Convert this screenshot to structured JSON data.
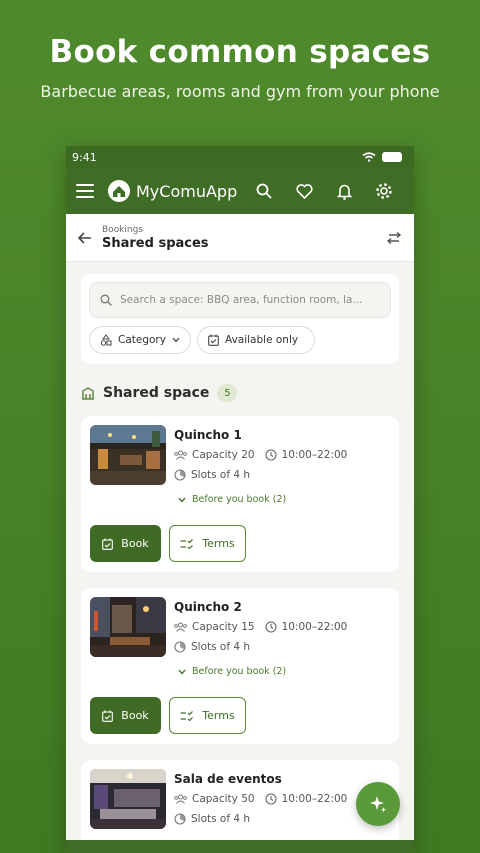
{
  "hero": {
    "title": "Book common spaces",
    "subtitle": "Barbecue areas, rooms and gym from your phone"
  },
  "status": {
    "time": "9:41"
  },
  "appbar": {
    "name": "MyComuApp"
  },
  "subheader": {
    "crumb": "Bookings",
    "title": "Shared spaces"
  },
  "search": {
    "placeholder": "Search a space: BBQ area, function room, la..."
  },
  "filters": {
    "category": "Category",
    "available": "Available only"
  },
  "section": {
    "title": "Shared space",
    "count": "5"
  },
  "spaces": [
    {
      "name": "Quincho 1",
      "capacity": "Capacity 20",
      "hours": "10:00–22:00",
      "slots": "Slots of 4 h",
      "before": "Before you book (2)",
      "book": "Book",
      "terms": "Terms"
    },
    {
      "name": "Quincho 2",
      "capacity": "Capacity 15",
      "hours": "10:00–22:00",
      "slots": "Slots of 4 h",
      "before": "Before you book (2)",
      "book": "Book",
      "terms": "Terms"
    },
    {
      "name": "Sala de eventos",
      "capacity": "Capacity 50",
      "hours": "10:00–22:00",
      "slots": "Slots of 4 h"
    }
  ],
  "colors": {
    "primary": "#406b25",
    "accent": "#5b9a3a",
    "background": "#4f8a2c"
  }
}
